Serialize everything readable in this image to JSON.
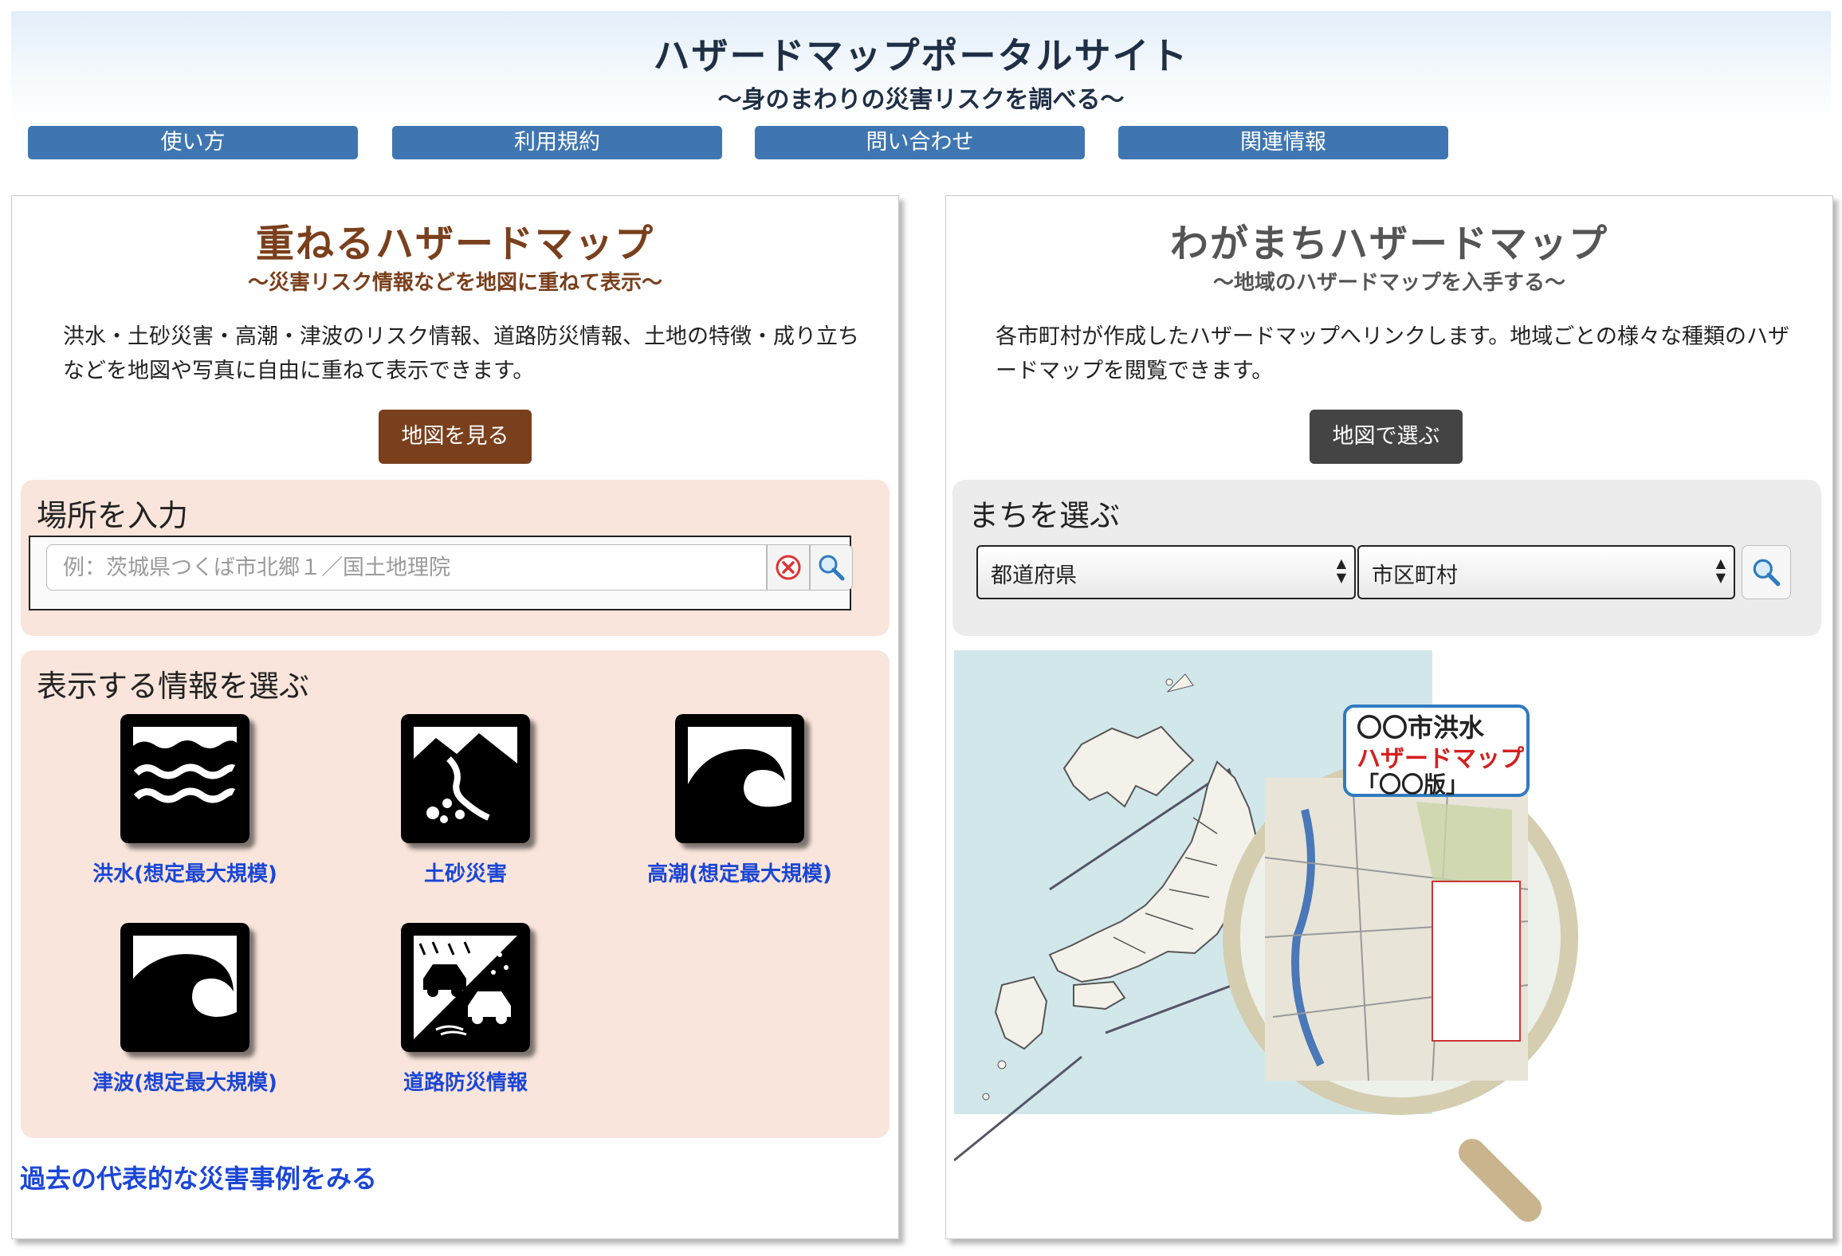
{
  "header": {
    "title": "ハザードマップポータルサイト",
    "subtitle": "〜身のまわりの災害リスクを調べる〜"
  },
  "nav": {
    "items": [
      {
        "label": "使い方"
      },
      {
        "label": "利用規約"
      },
      {
        "label": "問い合わせ"
      },
      {
        "label": "関連情報"
      }
    ]
  },
  "left_panel": {
    "title": "重ねるハザードマップ",
    "subtitle": "〜災害リスク情報などを地図に重ねて表示〜",
    "description": "洪水・土砂災害・高潮・津波のリスク情報、道路防災情報、土地の特徴・成り立ちなどを地図や写真に自由に重ねて表示できます。",
    "button_label": "地図を見る",
    "search": {
      "title": "場所を入力",
      "placeholder": "例：茨城県つくば市北郷１／国土地理院",
      "clear_icon": "clear-icon",
      "search_icon": "search-icon"
    },
    "info_select": {
      "title": "表示する情報を選ぶ",
      "items": [
        {
          "label": "洪水(想定最大規模)",
          "icon": "flood-icon"
        },
        {
          "label": "土砂災害",
          "icon": "landslide-icon"
        },
        {
          "label": "高潮(想定最大規模)",
          "icon": "storm-surge-icon"
        },
        {
          "label": "津波(想定最大規模)",
          "icon": "tsunami-icon"
        },
        {
          "label": "道路防災情報",
          "icon": "road-disaster-icon"
        }
      ]
    },
    "past_link": "過去の代表的な災害事例をみる"
  },
  "right_panel": {
    "title": "わがまちハザードマップ",
    "subtitle": "〜地域のハザードマップを入手する〜",
    "description": "各市町村が作成したハザードマップへリンクします。地域ごとの様々な種類のハザードマップを閲覧できます。",
    "button_label": "地図で選ぶ",
    "town_select": {
      "title": "まちを選ぶ",
      "prefecture": "都道府県",
      "municipality": "市区町村"
    },
    "illustration": {
      "sample_line1": "〇〇市洪水",
      "sample_line2": "ハザードマップ",
      "sample_line3": "「〇〇版」"
    }
  },
  "colors": {
    "nav_bg": "#3f76b2",
    "left_accent": "#7a3f1c",
    "left_box_bg": "#f9e5db",
    "right_title": "#555555",
    "right_button": "#444444",
    "right_box_bg": "#ececec",
    "link_blue": "#1b46d6"
  }
}
